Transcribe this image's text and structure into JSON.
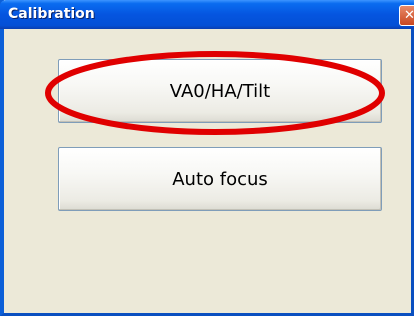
{
  "window": {
    "title": "Calibration",
    "close_glyph": "✕"
  },
  "buttons": {
    "vao_label": "VA0/HA/Tilt",
    "autofocus_label": "Auto focus"
  },
  "annotation": {
    "color": "#e00000",
    "target": "vao-ha-tilt-button"
  }
}
